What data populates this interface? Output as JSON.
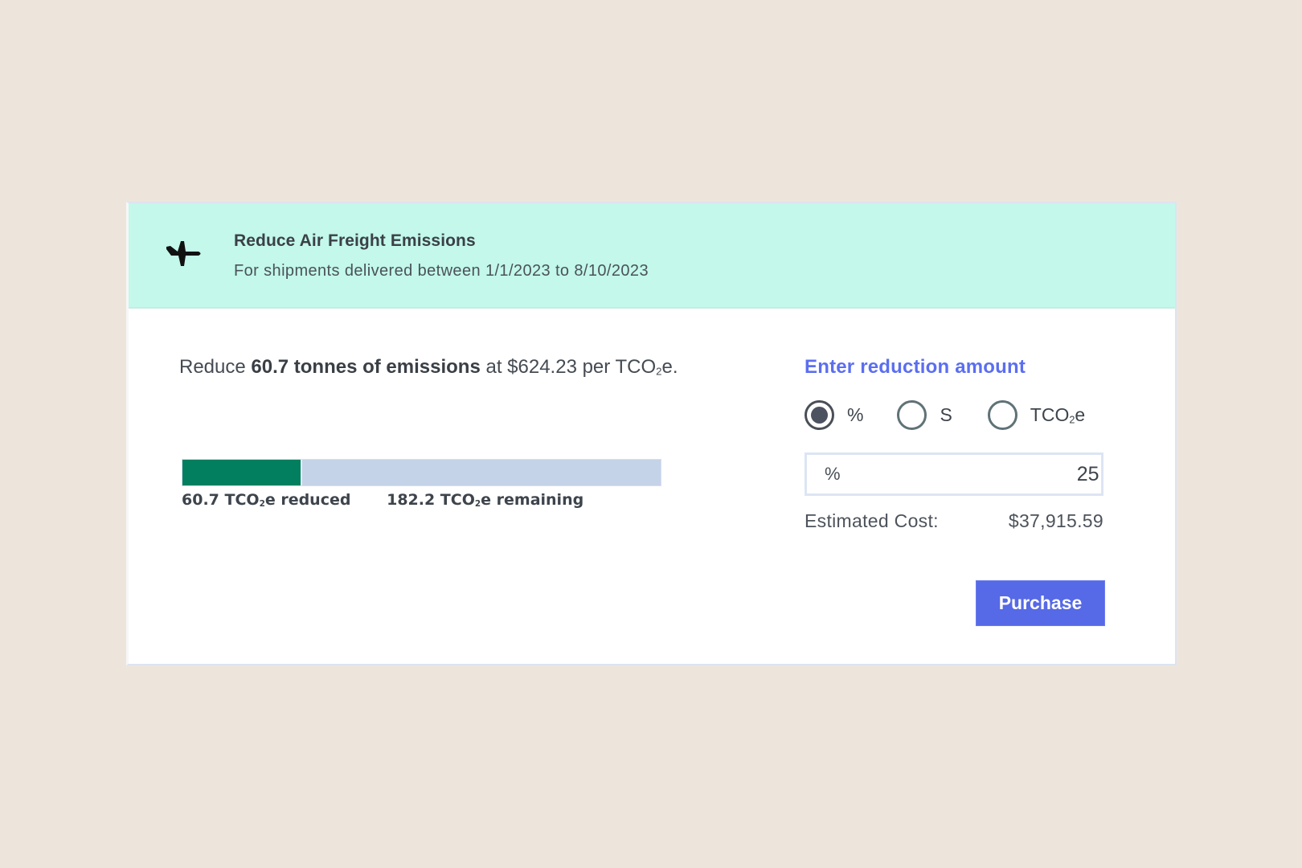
{
  "header": {
    "icon": "airplane-icon",
    "title": "Reduce Air Freight Emissions",
    "subtitle": "For shipments delivered between 1/1/2023 to 8/10/2023"
  },
  "summary": {
    "prefix": "Reduce ",
    "emphasis": "60.7 tonnes of emissions",
    "middle": " at $624.23 per TCO",
    "sub": "2",
    "suffix": "e."
  },
  "progress": {
    "reduced_tco2e": 60.7,
    "remaining_tco2e": 182.2,
    "reduced_fraction": 0.25,
    "reduced_label_num": "60.7 TCO",
    "reduced_label_suffix": "e reduced",
    "remaining_label_num": "182.2 TCO",
    "remaining_label_suffix": "e remaining",
    "subscript": "2",
    "colors": {
      "reduced": "#017f5f",
      "remaining": "#c5d3e8"
    }
  },
  "panel": {
    "title": "Enter reduction amount",
    "options": [
      {
        "label": "%",
        "checked": true
      },
      {
        "label": "S",
        "checked": false
      },
      {
        "label_main": "TCO",
        "label_sub": "2",
        "label_suffix": "e",
        "checked": false
      }
    ],
    "input": {
      "unit": "%",
      "value": "25"
    },
    "cost_label": "Estimated Cost:",
    "cost_value": "$37,915.59",
    "purchase_label": "Purchase",
    "accent_color": "#5669e6"
  }
}
